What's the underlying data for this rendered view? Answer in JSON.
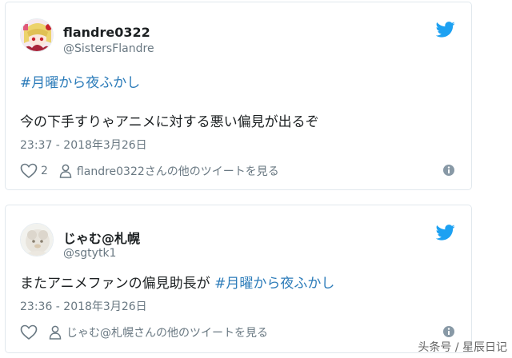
{
  "tweets": [
    {
      "display_name": "flandre0322",
      "handle": "@SistersFlandre",
      "hashtag": "#月曜から夜ふかし",
      "text": "今の下手すりゃアニメに対する悪い偏見が出るぞ",
      "timestamp": "23:37 - 2018年3月26日",
      "like_count": "2",
      "more_link": "flandre0322さんの他のツイートを見る"
    },
    {
      "display_name": "じゃむ@札幌",
      "handle": "@sgtytk1",
      "text": "またアニメファンの偏見助長が",
      "hashtag": "#月曜から夜ふかし",
      "timestamp": "23:36 - 2018年3月26日",
      "more_link": "じゃむ@札幌さんの他のツイートを見る"
    }
  ],
  "watermark": "头条号 / 星辰日记",
  "colors": {
    "accent": "#1da1f2",
    "link": "#2b7bb9",
    "muted": "#697882"
  },
  "icons": [
    "twitter-bird-icon",
    "heart-icon",
    "user-icon",
    "info-icon"
  ]
}
